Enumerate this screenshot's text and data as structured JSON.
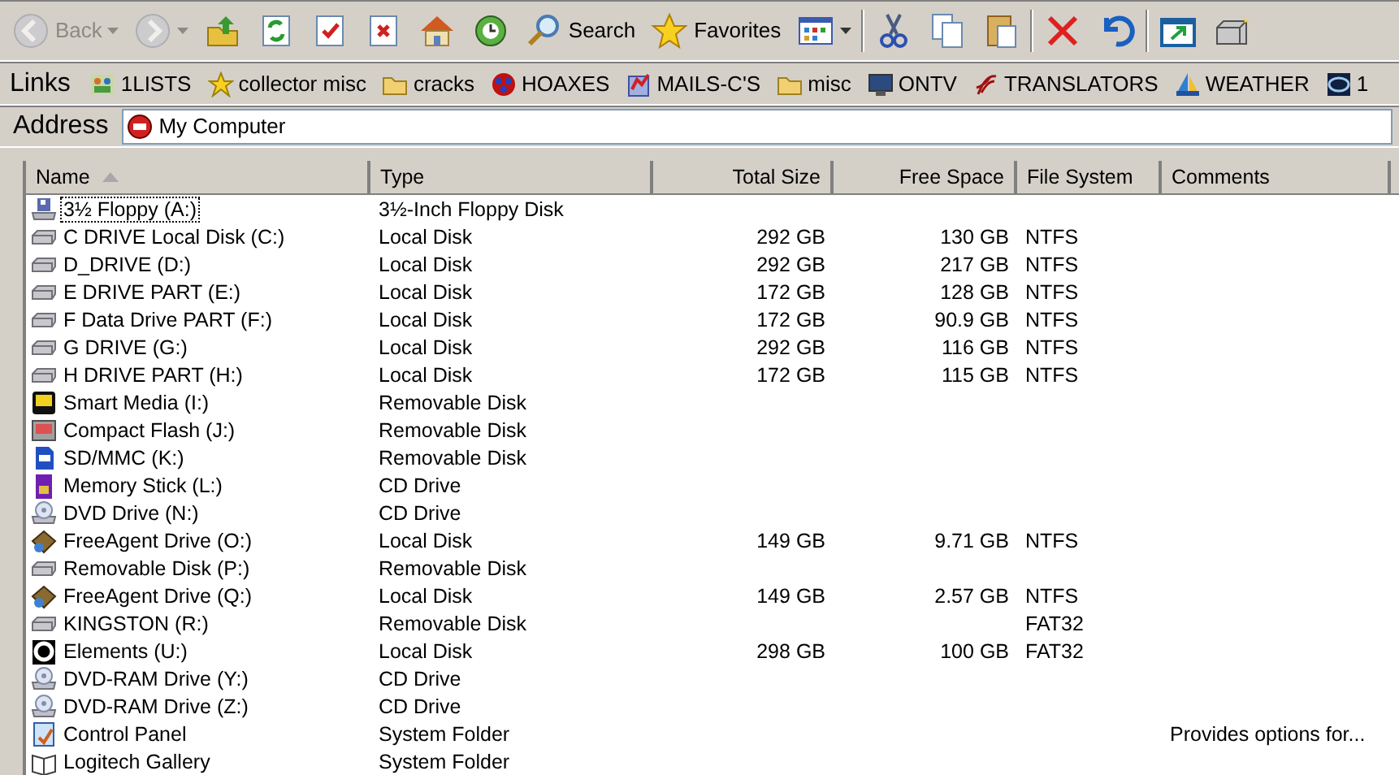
{
  "toolbar": [
    {
      "kind": "back",
      "label": "Back",
      "disabled": true,
      "dropdown": true
    },
    {
      "kind": "forward",
      "disabled": true,
      "dropdown": true
    },
    {
      "kind": "up",
      "disabled": false
    },
    {
      "kind": "refresh",
      "disabled": false
    },
    {
      "kind": "check",
      "disabled": false
    },
    {
      "kind": "stop",
      "disabled": false
    },
    {
      "kind": "home",
      "disabled": false
    },
    {
      "kind": "history",
      "disabled": false
    },
    {
      "kind": "search",
      "label": "Search",
      "disabled": false
    },
    {
      "kind": "favorites",
      "label": "Favorites",
      "disabled": false
    },
    {
      "kind": "views",
      "disabled": false,
      "dropdown": true
    },
    {
      "kind": "cut",
      "disabled": false
    },
    {
      "kind": "copy",
      "disabled": false
    },
    {
      "kind": "paste",
      "disabled": false
    },
    {
      "kind": "delete",
      "disabled": false
    },
    {
      "kind": "undo",
      "disabled": false
    },
    {
      "kind": "window",
      "disabled": false
    },
    {
      "kind": "box",
      "disabled": false
    }
  ],
  "links": {
    "label": "Links",
    "items": [
      {
        "label": "1LISTS",
        "kind": "people"
      },
      {
        "label": "collector misc",
        "kind": "star"
      },
      {
        "label": "cracks",
        "kind": "folder"
      },
      {
        "label": "HOAXES",
        "kind": "ball"
      },
      {
        "label": "MAILS-C'S",
        "kind": "mail"
      },
      {
        "label": "misc",
        "kind": "folder"
      },
      {
        "label": "ONTV",
        "kind": "monitor"
      },
      {
        "label": "TRANSLATORS",
        "kind": "swirl"
      },
      {
        "label": "WEATHER",
        "kind": "sail"
      },
      {
        "label": "1",
        "kind": "globe"
      }
    ]
  },
  "address": {
    "label": "Address",
    "value": "My Computer"
  },
  "table": {
    "columns": [
      {
        "label": "Name",
        "sorted": true
      },
      {
        "label": "Type",
        "sorted": false
      },
      {
        "label": "Total Size",
        "sorted": false
      },
      {
        "label": "Free Space",
        "sorted": false
      },
      {
        "label": "File System",
        "sorted": false
      },
      {
        "label": "Comments",
        "sorted": false
      }
    ],
    "rows": [
      {
        "kind": "floppy",
        "focused": true,
        "cells": [
          "3½ Floppy (A:)",
          "3½-Inch Floppy Disk",
          "",
          "",
          "",
          ""
        ]
      },
      {
        "kind": "hdd",
        "focused": false,
        "cells": [
          "C DRIVE Local Disk (C:)",
          "Local Disk",
          "292 GB",
          "130 GB",
          "NTFS",
          ""
        ]
      },
      {
        "kind": "hdd",
        "focused": false,
        "cells": [
          "D_DRIVE (D:)",
          "Local Disk",
          "292 GB",
          "217 GB",
          "NTFS",
          ""
        ]
      },
      {
        "kind": "hdd",
        "focused": false,
        "cells": [
          "E DRIVE PART (E:)",
          "Local Disk",
          "172 GB",
          "128 GB",
          "NTFS",
          ""
        ]
      },
      {
        "kind": "hdd",
        "focused": false,
        "cells": [
          "F Data Drive PART  (F:)",
          "Local Disk",
          "172 GB",
          "90.9 GB",
          "NTFS",
          ""
        ]
      },
      {
        "kind": "hdd",
        "focused": false,
        "cells": [
          "G DRIVE (G:)",
          "Local Disk",
          "292 GB",
          "116 GB",
          "NTFS",
          ""
        ]
      },
      {
        "kind": "hdd",
        "focused": false,
        "cells": [
          "H  DRIVE PART (H:)",
          "Local Disk",
          "172 GB",
          "115 GB",
          "NTFS",
          ""
        ]
      },
      {
        "kind": "smartmedia",
        "focused": false,
        "cells": [
          "Smart Media (I:)",
          "Removable Disk",
          "",
          "",
          "",
          ""
        ]
      },
      {
        "kind": "cf",
        "focused": false,
        "cells": [
          "Compact Flash (J:)",
          "Removable Disk",
          "",
          "",
          "",
          ""
        ]
      },
      {
        "kind": "sd",
        "focused": false,
        "cells": [
          "SD/MMC (K:)",
          "Removable Disk",
          "",
          "",
          "",
          ""
        ]
      },
      {
        "kind": "memstick",
        "focused": false,
        "cells": [
          "Memory Stick (L:)",
          "CD Drive",
          "",
          "",
          "",
          ""
        ]
      },
      {
        "kind": "cd",
        "focused": false,
        "cells": [
          "DVD Drive (N:)",
          "CD Drive",
          "",
          "",
          "",
          ""
        ]
      },
      {
        "kind": "freeagent",
        "focused": false,
        "cells": [
          "FreeAgent Drive (O:)",
          "Local Disk",
          "149 GB",
          "9.71 GB",
          "NTFS",
          ""
        ]
      },
      {
        "kind": "hdd",
        "focused": false,
        "cells": [
          "Removable Disk (P:)",
          "Removable Disk",
          "",
          "",
          "",
          ""
        ]
      },
      {
        "kind": "freeagent",
        "focused": false,
        "cells": [
          "FreeAgent Drive (Q:)",
          "Local Disk",
          "149 GB",
          "2.57 GB",
          "NTFS",
          ""
        ]
      },
      {
        "kind": "hdd",
        "focused": false,
        "cells": [
          "KINGSTON (R:)",
          "Removable Disk",
          "",
          "",
          "FAT32",
          ""
        ]
      },
      {
        "kind": "elements",
        "focused": false,
        "cells": [
          "Elements (U:)",
          "Local Disk",
          "298 GB",
          "100 GB",
          "FAT32",
          ""
        ]
      },
      {
        "kind": "cd",
        "focused": false,
        "cells": [
          "DVD-RAM Drive (Y:)",
          "CD Drive",
          "",
          "",
          "",
          ""
        ]
      },
      {
        "kind": "cd",
        "focused": false,
        "cells": [
          "DVD-RAM Drive (Z:)",
          "CD Drive",
          "",
          "",
          "",
          ""
        ]
      },
      {
        "kind": "controlpanel",
        "focused": false,
        "cells": [
          "Control Panel",
          "System Folder",
          "",
          "",
          "",
          "Provides options for..."
        ]
      },
      {
        "kind": "gallery",
        "focused": false,
        "cells": [
          "Logitech Gallery",
          "System Folder",
          "",
          "",
          "",
          ""
        ]
      }
    ]
  }
}
